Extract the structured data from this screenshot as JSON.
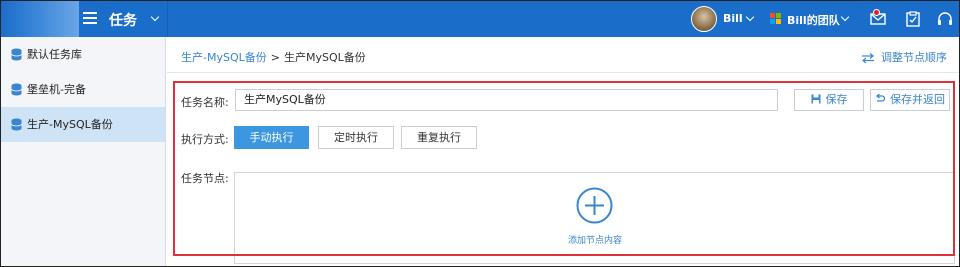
{
  "header": {
    "app_title": "任务",
    "user_name": "Bill",
    "team_name": "Bill的团队",
    "icons": [
      "menu-icon",
      "mail-icon",
      "clipboard-check-icon",
      "headset-icon"
    ],
    "accent_color": "#1a6dc9"
  },
  "sidebar": {
    "items": [
      {
        "label": "默认任务库",
        "active": false
      },
      {
        "label": "堡垒机-完备",
        "active": false
      },
      {
        "label": "生产-MySQL备份",
        "active": true
      }
    ]
  },
  "breadcrumb": {
    "parent": "生产-MySQL备份",
    "separator": ">",
    "current": "生产MySQL备份"
  },
  "adjust_order_label": "调整节点顺序",
  "form": {
    "name_label": "任务名称:",
    "name_value": "生产MySQL备份",
    "save_label": "保存",
    "save_return_label": "保存并返回",
    "mode_label": "执行方式:",
    "modes": [
      "手动执行",
      "定时执行",
      "重复执行"
    ],
    "selected_mode": "手动执行",
    "node_label": "任务节点:",
    "add_node_label": "添加节点内容"
  },
  "colors": {
    "highlight_border": "#e0303a",
    "selected_mode": "#3d97e0",
    "link": "#3a85d0"
  }
}
